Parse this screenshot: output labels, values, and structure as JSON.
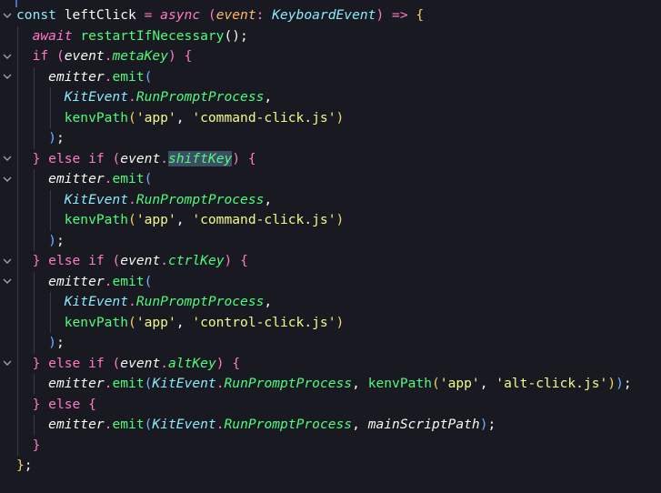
{
  "code": {
    "lines": [
      {
        "fold": true,
        "segments": [
          {
            "t": "const",
            "c": "kw-storage"
          },
          {
            "t": " ",
            "c": "plain"
          },
          {
            "t": "leftClick",
            "c": "plain"
          },
          {
            "t": " = ",
            "c": "kw"
          },
          {
            "t": "async",
            "c": "kw-italic"
          },
          {
            "t": " ",
            "c": "plain"
          },
          {
            "t": "(",
            "c": "br-p"
          },
          {
            "t": "event",
            "c": "param"
          },
          {
            "t": ": ",
            "c": "kw"
          },
          {
            "t": "KeyboardEvent",
            "c": "type"
          },
          {
            "t": ")",
            "c": "br-p"
          },
          {
            "t": " => ",
            "c": "kw"
          },
          {
            "t": "{",
            "c": "br-y"
          }
        ]
      },
      {
        "fold": false,
        "segments": [
          {
            "t": "  ",
            "c": "plain"
          },
          {
            "t": "await",
            "c": "kw-italic"
          },
          {
            "t": " ",
            "c": "plain"
          },
          {
            "t": "restartIfNecessary",
            "c": "fn"
          },
          {
            "t": "();",
            "c": "plain"
          }
        ]
      },
      {
        "fold": true,
        "segments": [
          {
            "t": "  ",
            "c": "plain"
          },
          {
            "t": "if",
            "c": "kw"
          },
          {
            "t": " ",
            "c": "plain"
          },
          {
            "t": "(",
            "c": "br-p"
          },
          {
            "t": "event",
            "c": "plain italic"
          },
          {
            "t": ".",
            "c": "kw"
          },
          {
            "t": "metaKey",
            "c": "prop"
          },
          {
            "t": ")",
            "c": "br-p"
          },
          {
            "t": " ",
            "c": "plain"
          },
          {
            "t": "{",
            "c": "br-p"
          }
        ]
      },
      {
        "fold": true,
        "segments": [
          {
            "t": "    ",
            "c": "plain"
          },
          {
            "t": "emitter",
            "c": "plain italic"
          },
          {
            "t": ".",
            "c": "kw"
          },
          {
            "t": "emit",
            "c": "fn"
          },
          {
            "t": "(",
            "c": "br-b"
          }
        ]
      },
      {
        "fold": false,
        "segments": [
          {
            "t": "      ",
            "c": "plain"
          },
          {
            "t": "KitEvent",
            "c": "cls"
          },
          {
            "t": ".",
            "c": "kw"
          },
          {
            "t": "RunPromptProcess",
            "c": "prop"
          },
          {
            "t": ",",
            "c": "plain"
          }
        ]
      },
      {
        "fold": false,
        "segments": [
          {
            "t": "      ",
            "c": "plain"
          },
          {
            "t": "kenvPath",
            "c": "fn"
          },
          {
            "t": "(",
            "c": "br-y"
          },
          {
            "t": "'app'",
            "c": "str"
          },
          {
            "t": ", ",
            "c": "plain"
          },
          {
            "t": "'command-click.js'",
            "c": "str"
          },
          {
            "t": ")",
            "c": "br-y"
          }
        ]
      },
      {
        "fold": false,
        "segments": [
          {
            "t": "    ",
            "c": "plain"
          },
          {
            "t": ")",
            "c": "br-b"
          },
          {
            "t": ";",
            "c": "plain"
          }
        ]
      },
      {
        "fold": true,
        "segments": [
          {
            "t": "  ",
            "c": "plain"
          },
          {
            "t": "}",
            "c": "br-p"
          },
          {
            "t": " ",
            "c": "plain"
          },
          {
            "t": "else",
            "c": "kw"
          },
          {
            "t": " ",
            "c": "plain"
          },
          {
            "t": "if",
            "c": "kw"
          },
          {
            "t": " ",
            "c": "plain"
          },
          {
            "t": "(",
            "c": "br-p"
          },
          {
            "t": "event",
            "c": "plain italic"
          },
          {
            "t": ".",
            "c": "kw"
          },
          {
            "t": "shiftKey",
            "c": "prop hlword"
          },
          {
            "t": ")",
            "c": "br-p"
          },
          {
            "t": " ",
            "c": "plain"
          },
          {
            "t": "{",
            "c": "br-p"
          }
        ]
      },
      {
        "fold": true,
        "segments": [
          {
            "t": "    ",
            "c": "plain"
          },
          {
            "t": "emitter",
            "c": "plain italic"
          },
          {
            "t": ".",
            "c": "kw"
          },
          {
            "t": "emit",
            "c": "fn"
          },
          {
            "t": "(",
            "c": "br-b"
          }
        ]
      },
      {
        "fold": false,
        "segments": [
          {
            "t": "      ",
            "c": "plain"
          },
          {
            "t": "KitEvent",
            "c": "cls"
          },
          {
            "t": ".",
            "c": "kw"
          },
          {
            "t": "RunPromptProcess",
            "c": "prop"
          },
          {
            "t": ",",
            "c": "plain"
          }
        ]
      },
      {
        "fold": false,
        "segments": [
          {
            "t": "      ",
            "c": "plain"
          },
          {
            "t": "kenvPath",
            "c": "fn"
          },
          {
            "t": "(",
            "c": "br-y"
          },
          {
            "t": "'app'",
            "c": "str"
          },
          {
            "t": ", ",
            "c": "plain"
          },
          {
            "t": "'command-click.js'",
            "c": "str"
          },
          {
            "t": ")",
            "c": "br-y"
          }
        ]
      },
      {
        "fold": false,
        "segments": [
          {
            "t": "    ",
            "c": "plain"
          },
          {
            "t": ")",
            "c": "br-b"
          },
          {
            "t": ";",
            "c": "plain"
          }
        ]
      },
      {
        "fold": true,
        "segments": [
          {
            "t": "  ",
            "c": "plain"
          },
          {
            "t": "}",
            "c": "br-p"
          },
          {
            "t": " ",
            "c": "plain"
          },
          {
            "t": "else",
            "c": "kw"
          },
          {
            "t": " ",
            "c": "plain"
          },
          {
            "t": "if",
            "c": "kw"
          },
          {
            "t": " ",
            "c": "plain"
          },
          {
            "t": "(",
            "c": "br-p"
          },
          {
            "t": "event",
            "c": "plain italic"
          },
          {
            "t": ".",
            "c": "kw"
          },
          {
            "t": "ctrlKey",
            "c": "prop"
          },
          {
            "t": ")",
            "c": "br-p"
          },
          {
            "t": " ",
            "c": "plain"
          },
          {
            "t": "{",
            "c": "br-p"
          }
        ]
      },
      {
        "fold": true,
        "segments": [
          {
            "t": "    ",
            "c": "plain"
          },
          {
            "t": "emitter",
            "c": "plain italic"
          },
          {
            "t": ".",
            "c": "kw"
          },
          {
            "t": "emit",
            "c": "fn"
          },
          {
            "t": "(",
            "c": "br-b"
          }
        ]
      },
      {
        "fold": false,
        "segments": [
          {
            "t": "      ",
            "c": "plain"
          },
          {
            "t": "KitEvent",
            "c": "cls"
          },
          {
            "t": ".",
            "c": "kw"
          },
          {
            "t": "RunPromptProcess",
            "c": "prop"
          },
          {
            "t": ",",
            "c": "plain"
          }
        ]
      },
      {
        "fold": false,
        "segments": [
          {
            "t": "      ",
            "c": "plain"
          },
          {
            "t": "kenvPath",
            "c": "fn"
          },
          {
            "t": "(",
            "c": "br-y"
          },
          {
            "t": "'app'",
            "c": "str"
          },
          {
            "t": ", ",
            "c": "plain"
          },
          {
            "t": "'control-click.js'",
            "c": "str"
          },
          {
            "t": ")",
            "c": "br-y"
          }
        ]
      },
      {
        "fold": false,
        "segments": [
          {
            "t": "    ",
            "c": "plain"
          },
          {
            "t": ")",
            "c": "br-b"
          },
          {
            "t": ";",
            "c": "plain"
          }
        ]
      },
      {
        "fold": true,
        "segments": [
          {
            "t": "  ",
            "c": "plain"
          },
          {
            "t": "}",
            "c": "br-p"
          },
          {
            "t": " ",
            "c": "plain"
          },
          {
            "t": "else",
            "c": "kw"
          },
          {
            "t": " ",
            "c": "plain"
          },
          {
            "t": "if",
            "c": "kw"
          },
          {
            "t": " ",
            "c": "plain"
          },
          {
            "t": "(",
            "c": "br-p"
          },
          {
            "t": "event",
            "c": "plain italic"
          },
          {
            "t": ".",
            "c": "kw"
          },
          {
            "t": "altKey",
            "c": "prop"
          },
          {
            "t": ")",
            "c": "br-p"
          },
          {
            "t": " ",
            "c": "plain"
          },
          {
            "t": "{",
            "c": "br-p"
          }
        ]
      },
      {
        "fold": false,
        "segments": [
          {
            "t": "    ",
            "c": "plain"
          },
          {
            "t": "emitter",
            "c": "plain italic"
          },
          {
            "t": ".",
            "c": "kw"
          },
          {
            "t": "emit",
            "c": "fn"
          },
          {
            "t": "(",
            "c": "br-b"
          },
          {
            "t": "KitEvent",
            "c": "cls"
          },
          {
            "t": ".",
            "c": "kw"
          },
          {
            "t": "RunPromptProcess",
            "c": "prop"
          },
          {
            "t": ", ",
            "c": "plain"
          },
          {
            "t": "kenvPath",
            "c": "fn"
          },
          {
            "t": "(",
            "c": "br-y"
          },
          {
            "t": "'app'",
            "c": "str"
          },
          {
            "t": ", ",
            "c": "plain"
          },
          {
            "t": "'alt-click.js'",
            "c": "str"
          },
          {
            "t": ")",
            "c": "br-y"
          },
          {
            "t": ")",
            "c": "br-b"
          },
          {
            "t": ";",
            "c": "plain"
          }
        ]
      },
      {
        "fold": false,
        "segments": [
          {
            "t": "  ",
            "c": "plain"
          },
          {
            "t": "}",
            "c": "br-p"
          },
          {
            "t": " ",
            "c": "plain"
          },
          {
            "t": "else",
            "c": "kw"
          },
          {
            "t": " ",
            "c": "plain"
          },
          {
            "t": "{",
            "c": "br-p"
          }
        ]
      },
      {
        "fold": false,
        "segments": [
          {
            "t": "    ",
            "c": "plain"
          },
          {
            "t": "emitter",
            "c": "plain italic"
          },
          {
            "t": ".",
            "c": "kw"
          },
          {
            "t": "emit",
            "c": "fn"
          },
          {
            "t": "(",
            "c": "br-b"
          },
          {
            "t": "KitEvent",
            "c": "cls"
          },
          {
            "t": ".",
            "c": "kw"
          },
          {
            "t": "RunPromptProcess",
            "c": "prop"
          },
          {
            "t": ", ",
            "c": "plain"
          },
          {
            "t": "mainScriptPath",
            "c": "plain italic"
          },
          {
            "t": ")",
            "c": "br-b"
          },
          {
            "t": ";",
            "c": "plain"
          }
        ]
      },
      {
        "fold": false,
        "segments": [
          {
            "t": "  ",
            "c": "plain"
          },
          {
            "t": "}",
            "c": "br-p"
          }
        ]
      },
      {
        "fold": false,
        "segments": [
          {
            "t": "}",
            "c": "br-y"
          },
          {
            "t": ";",
            "c": "plain"
          }
        ]
      }
    ]
  },
  "colors": {
    "background": "#191a21",
    "highlight": "#3b4e63"
  },
  "icons": {
    "fold": "chevron-down-icon"
  }
}
